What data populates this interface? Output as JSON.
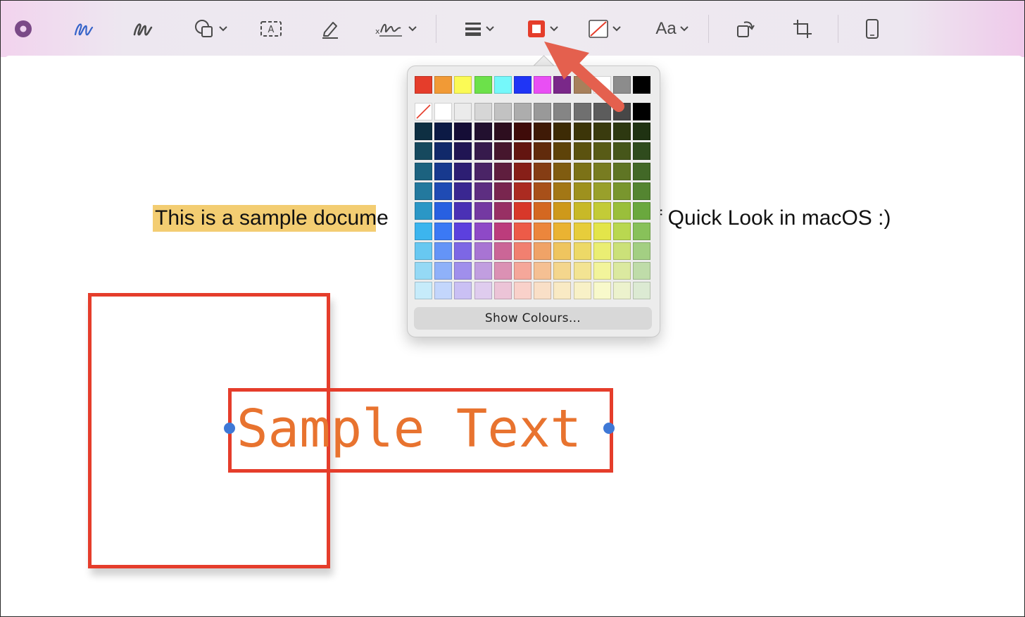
{
  "toolbar": {
    "items": [
      {
        "icon": "sketch-icon"
      },
      {
        "icon": "draw-icon"
      },
      {
        "icon": "shapes-icon"
      },
      {
        "icon": "text-box-icon"
      },
      {
        "icon": "highlight-icon"
      },
      {
        "icon": "sign-icon"
      },
      {
        "icon": "shape-style-icon"
      },
      {
        "icon": "border-color-icon",
        "color": "#e53d2b"
      },
      {
        "icon": "fill-color-icon"
      },
      {
        "icon": "text-style-icon",
        "label": "Aa"
      },
      {
        "icon": "rotate-icon"
      },
      {
        "icon": "crop-icon"
      },
      {
        "icon": "device-icon"
      }
    ]
  },
  "document": {
    "line_part1": "This is a sample docume",
    "line_part2": "f Quick Look in macOS :)",
    "highlight_color": "#f3cd72",
    "text_box_content": "Sample Text",
    "annotation_color": "#e53d2b",
    "text_color": "#e8732f"
  },
  "color_picker": {
    "show_colours_label": "Show Colours…",
    "top_row": [
      "#e53d2b",
      "#f19a36",
      "#fbfa55",
      "#6ce14a",
      "#75f8fa",
      "#1f35f6",
      "#e94ff4",
      "#7a2889",
      "#a7805b",
      "#ffffff",
      "#8c8c8c",
      "#000000"
    ],
    "gray_row": [
      "none",
      "#ffffff",
      "#ebebeb",
      "#d6d6d6",
      "#c2c2c2",
      "#adadad",
      "#999999",
      "#858585",
      "#707070",
      "#5c5c5c",
      "#474747",
      "#000000"
    ],
    "grid": [
      [
        "#0e2f42",
        "#0c1a45",
        "#150d36",
        "#22102f",
        "#2d0e1f",
        "#3f0b09",
        "#3f1a06",
        "#3d2b05",
        "#3c3508",
        "#3a3b0e",
        "#2d3810",
        "#1f3212"
      ],
      [
        "#16495e",
        "#11296a",
        "#201553",
        "#361a4c",
        "#46162d",
        "#631510",
        "#612b0c",
        "#5e4309",
        "#5b520f",
        "#585b16",
        "#46561a",
        "#2f4b1d"
      ],
      [
        "#1c627f",
        "#17398e",
        "#2d1e73",
        "#4a2466",
        "#5f1e3e",
        "#871f18",
        "#853d14",
        "#805c10",
        "#7c7217",
        "#787c21",
        "#5f7524",
        "#426827"
      ],
      [
        "#23799e",
        "#1f4bb4",
        "#3a2791",
        "#5d2e81",
        "#79264f",
        "#ab2b21",
        "#a85019",
        "#a37715",
        "#9e911e",
        "#99a02b",
        "#79962e",
        "#548531"
      ],
      [
        "#2b97c6",
        "#2860e1",
        "#4a31b5",
        "#7439a2",
        "#983064",
        "#d8382a",
        "#d46821",
        "#ce991b",
        "#c8b928",
        "#c3cb37",
        "#9abf3b",
        "#6aa83e"
      ],
      [
        "#3cb5ee",
        "#3b79f5",
        "#5c40de",
        "#8e49c7",
        "#bc3c7c",
        "#ed5b48",
        "#ec863c",
        "#eab332",
        "#e7cd3b",
        "#e3e54a",
        "#b9d850",
        "#88c15a"
      ],
      [
        "#68c8f1",
        "#6494f7",
        "#7d67e5",
        "#a874d3",
        "#cb6697",
        "#f18070",
        "#f0a367",
        "#efc55f",
        "#edd967",
        "#eaee73",
        "#cbe179",
        "#a3cf83"
      ],
      [
        "#95d9f5",
        "#8fb1f9",
        "#a08fec",
        "#c19ee0",
        "#db91b4",
        "#f5a79a",
        "#f5c093",
        "#f4d68d",
        "#f3e493",
        "#f2f49b",
        "#dbe9a0",
        "#bfdca9"
      ],
      [
        "#c6ebfa",
        "#c3d6fc",
        "#cac0f4",
        "#dfccee",
        "#ecc4d7",
        "#f9d1ca",
        "#f9dfc7",
        "#f9eac4",
        "#f8f1c7",
        "#f8f9cb",
        "#ecf2cd",
        "#dcead3"
      ]
    ]
  }
}
